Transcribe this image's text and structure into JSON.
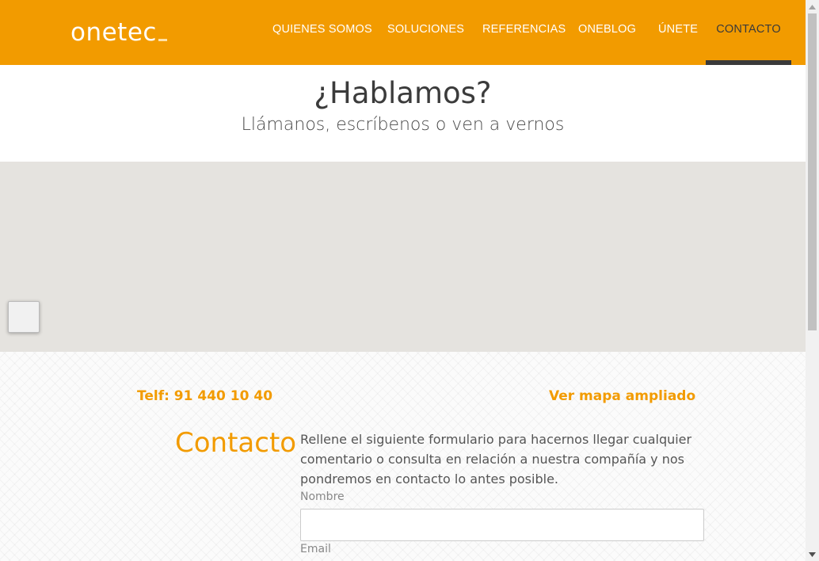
{
  "brand": {
    "logo_text": "onetec",
    "accent": "#f29b00",
    "dark": "#3a3a3a"
  },
  "nav": {
    "items": [
      {
        "label": "QUIENES SOMOS"
      },
      {
        "label": "SOLUCIONES"
      },
      {
        "label": "REFERENCIAS"
      },
      {
        "label": "ONEBLOG"
      },
      {
        "label": "ÚNETE"
      },
      {
        "label": "CONTACTO",
        "active": true
      }
    ]
  },
  "hero": {
    "title": "¿Hablamos?",
    "subtitle": "Llámanos, escríbenos o ven a vernos"
  },
  "contact_info": {
    "phone": "Telf: 91 440 10 40",
    "map_link": "Ver mapa ampliado"
  },
  "contact_form": {
    "title": "Contacto",
    "description": "Rellene el siguiente formulario para hacernos llegar cualquier comentario o consulta en relación a nuestra compañía y nos pondremos en contacto lo antes posible.",
    "fields": [
      {
        "label": "Nombre",
        "value": ""
      },
      {
        "label": "Email",
        "value": ""
      }
    ]
  }
}
